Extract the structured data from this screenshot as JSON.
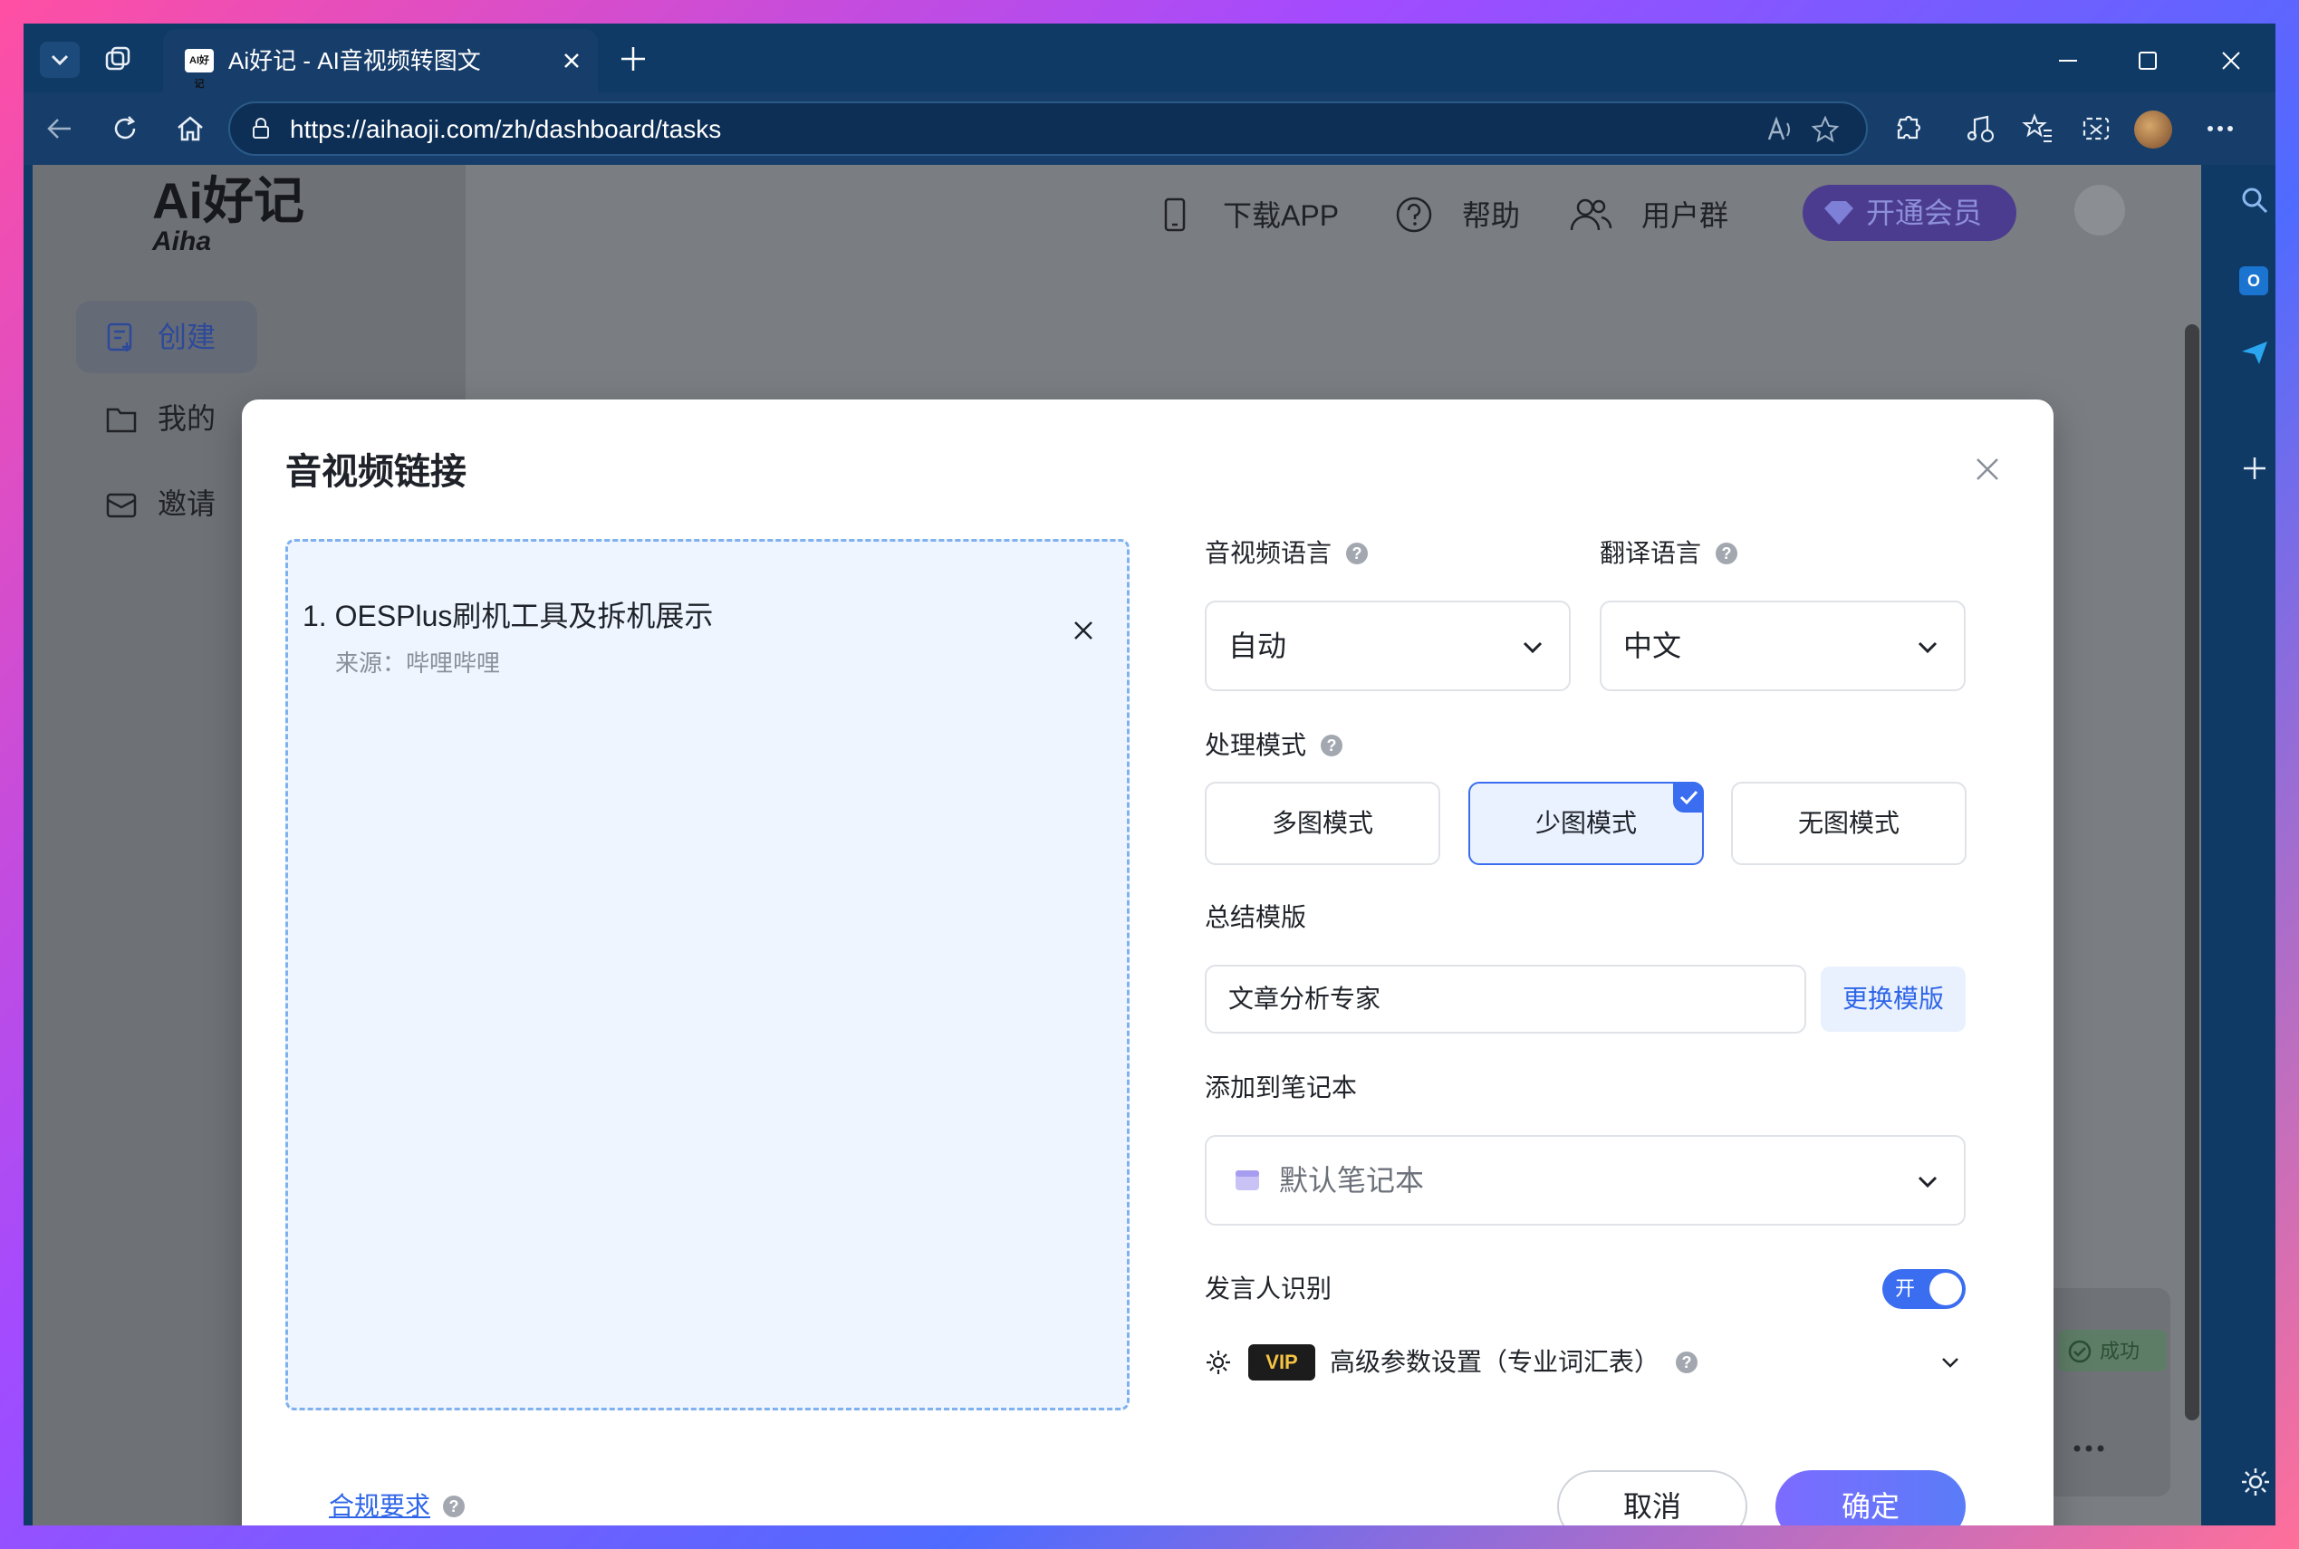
{
  "browser": {
    "tab_title": "Ai好记 - AI音视频转图文",
    "tab_favicon_text": "AI好记",
    "url": "https://aihaoji.com/zh/dashboard/tasks"
  },
  "site": {
    "logo": "Ai好记",
    "logo_sub": "Aiha",
    "header": {
      "download_app": "下载APP",
      "help": "帮助",
      "user_group": "用户群",
      "vip_button": "开通会员"
    },
    "sidebar": {
      "items": [
        {
          "label": "创建",
          "icon": "create-icon"
        },
        {
          "label": "我的",
          "icon": "folder-icon"
        },
        {
          "label": "邀请",
          "icon": "mail-icon"
        }
      ]
    },
    "background_task": {
      "status": "成功"
    }
  },
  "dialog": {
    "title": "音视频链接",
    "link_item": {
      "title": "1. OESPlus刷机工具及拆机展示",
      "source": "来源：哔哩哔哩"
    },
    "audio_language": {
      "label": "音视频语言",
      "value": "自动"
    },
    "translate_language": {
      "label": "翻译语言",
      "value": "中文"
    },
    "process_mode": {
      "label": "处理模式",
      "options": [
        "多图模式",
        "少图模式",
        "无图模式"
      ],
      "selected": "少图模式"
    },
    "summary_template": {
      "label": "总结模版",
      "value": "文章分析专家",
      "change_button": "更换模版"
    },
    "notebook": {
      "label": "添加到笔记本",
      "value": "默认笔记本"
    },
    "speaker_recognition": {
      "label": "发言人识别",
      "toggle_text": "开",
      "enabled": true
    },
    "advanced": {
      "vip_badge": "VIP",
      "label": "高级参数设置（专业词汇表）"
    },
    "compliance_link": "合规要求",
    "cancel_button": "取消",
    "ok_button": "确定"
  },
  "colors": {
    "accent": "#3a6df0",
    "browser_frame": "#0f3a66",
    "vip_gold": "#f5c443"
  }
}
